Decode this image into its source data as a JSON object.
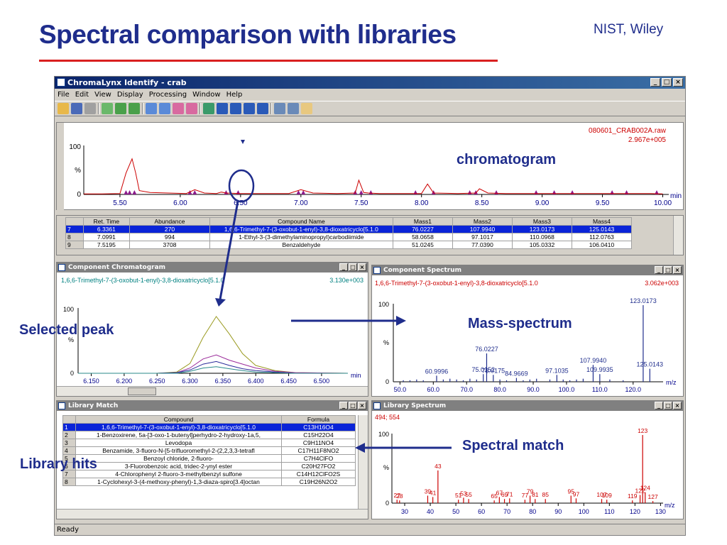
{
  "slide": {
    "title": "Spectral comparison with libraries",
    "source": "NIST, Wiley"
  },
  "app": {
    "title": "ChromaLynx Identify - crab",
    "menu": [
      "File",
      "Edit",
      "View",
      "Display",
      "Processing",
      "Window",
      "Help"
    ],
    "status": "Ready"
  },
  "chromatogram": {
    "file": "080601_CRAB002A.raw",
    "intensity": "2.967e+005",
    "y_top": "100",
    "y_pct": "%",
    "y_zero": "0",
    "x_unit": "min",
    "x_ticks": [
      "5.50",
      "6.00",
      "6.50",
      "7.00",
      "7.50",
      "8.00",
      "8.50",
      "9.00",
      "9.50",
      "10.00"
    ]
  },
  "results_table": {
    "headers": [
      "",
      "Ret. Time",
      "Abundance",
      "Compound Name",
      "Mass1",
      "Mass2",
      "Mass3",
      "Mass4"
    ],
    "rows": [
      [
        "7",
        "6.3361",
        "270",
        "1,6,6-Trimethyl-7-(3-oxobut-1-enyl)-3,8-dioxatricyclo[5.1.0",
        "76.0227",
        "107.9940",
        "123.0173",
        "125.0143"
      ],
      [
        "8",
        "7.0991",
        "994",
        "1-Ethyl-3-(3-dimethylaminopropyl)carbodiimide",
        "58.0658",
        "97.1017",
        "110.0968",
        "112.0763"
      ],
      [
        "9",
        "7.5195",
        "3708",
        "Benzaldehyde",
        "51.0245",
        "77.0390",
        "105.0332",
        "106.0410"
      ]
    ]
  },
  "component_chromatogram": {
    "title": "Component Chromatogram",
    "compound": "1,6,6-Trimethyl-7-(3-oxobut-1-enyl)-3,8-dioxatricyclo[5.1.0",
    "intensity": "3.130e+003",
    "y_top": "100",
    "y_pct": "%",
    "y_zero": "0",
    "x_unit": "min",
    "x_ticks": [
      "6.150",
      "6.200",
      "6.250",
      "6.300",
      "6.350",
      "6.400",
      "6.450",
      "6.500"
    ]
  },
  "component_spectrum": {
    "title": "Component Spectrum",
    "compound": "1,6,6-Trimethyl-7-(3-oxobut-1-enyl)-3,8-dioxatricyclo[5.1.0",
    "intensity": "3.062e+003",
    "y_top": "100",
    "y_pct": "%",
    "y_zero": "0",
    "x_unit": "m/z",
    "x_ticks": [
      "50.0",
      "60.0",
      "70.0",
      "80.0",
      "90.0",
      "100.0",
      "110.0",
      "120.0"
    ],
    "peak_labels": [
      "60.9996",
      "75.0152",
      "76.0227",
      "78.0175",
      "84.9669",
      "97.1035",
      "107.9940",
      "109.9935",
      "123.0173",
      "125.0143"
    ]
  },
  "library_match": {
    "title": "Library Match",
    "headers": [
      "",
      "Compound",
      "Formula"
    ],
    "rows": [
      [
        "1",
        "1,6,6-Trimethyl-7-(3-oxobut-1-enyl)-3,8-dioxatricyclo[5.1.0",
        "C13H16O4"
      ],
      [
        "2",
        "1-Benzoxirene, 5a-[3-oxo-1-butenyl]perhydro-2-hydroxy-1a,5,",
        "C15H22O4"
      ],
      [
        "3",
        "Levodopa",
        "C9H11NO4"
      ],
      [
        "4",
        "Benzamide, 3-fluoro-N-[5-trifluoromethyl-2-(2,2,3,3-tetrafl",
        "C17H11F8NO2"
      ],
      [
        "5",
        "Benzoyl chloride, 2-fluoro-",
        "C7H4ClFO"
      ],
      [
        "6",
        "3-Fluorobenzoic acid, tridec-2-ynyl ester",
        "C20H27FO2"
      ],
      [
        "7",
        "4-Chlorophenyl 2-fluoro-3-methylbenzyl sulfone",
        "C14H12ClFO2S"
      ],
      [
        "8",
        "1-Cyclohexyl-3-(4-methoxy-phenyl)-1,3-diaza-spiro[3.4]octan",
        "C19H26N2O2"
      ]
    ]
  },
  "library_spectrum": {
    "title": "Library Spectrum",
    "header": "494; 554",
    "y_top": "100",
    "y_pct": "%",
    "y_zero": "0",
    "x_unit": "m/z",
    "x_ticks": [
      "30",
      "40",
      "50",
      "60",
      "70",
      "80",
      "90",
      "100",
      "110",
      "120",
      "130"
    ],
    "peak_labels": [
      "27",
      "28",
      "39",
      "41",
      "43",
      "51",
      "53",
      "55",
      "65",
      "67",
      "69",
      "71",
      "77",
      "79",
      "81",
      "85",
      "95",
      "97",
      "107",
      "109",
      "119",
      "122",
      "123",
      "124",
      "127"
    ]
  },
  "annotations": {
    "chromatogram": "chromatogram",
    "mass_spectrum": "Mass-spectrum",
    "selected_peak": "Selected peak",
    "spectral_match": "Spectral match",
    "library_hits": "Library hits"
  },
  "colors": {
    "accent_blue": "#1f2d8c",
    "title_rule": "#d92020",
    "trace_red": "#cc0000",
    "selection": "#0a24d8"
  },
  "chart_data": [
    {
      "type": "line",
      "title": "080601_CRAB002A.raw",
      "xlabel": "min",
      "xlim": [
        5.2,
        10.05
      ],
      "ylim": [
        0,
        100
      ],
      "series": [
        {
          "x": [
            5.2,
            5.35,
            5.5,
            5.55,
            5.6,
            5.63,
            5.66,
            5.75,
            5.9,
            6.05,
            6.12,
            6.2,
            6.3,
            6.34,
            6.38,
            6.5,
            6.7,
            6.9,
            7.0,
            7.1,
            7.3,
            7.45,
            7.48,
            7.52,
            7.56,
            7.65,
            7.8,
            8.0,
            8.05,
            8.1,
            8.3,
            8.45,
            8.48,
            8.55,
            8.7,
            9.0,
            9.3,
            9.6,
            9.9,
            10.0
          ],
          "y": [
            1,
            1,
            2,
            45,
            75,
            45,
            8,
            4,
            3,
            2,
            10,
            3,
            2,
            5,
            3,
            2,
            2,
            2,
            10,
            3,
            2,
            3,
            30,
            4,
            3,
            2,
            2,
            2,
            22,
            3,
            2,
            3,
            12,
            3,
            2,
            2,
            2,
            2,
            2,
            1
          ]
        }
      ]
    },
    {
      "type": "line",
      "title": "1,6,6-Trimethyl-7-(3-oxobut-1-enyl)-3,8-dioxatricyclo[5.1.0",
      "xlabel": "min",
      "xlim": [
        6.13,
        6.54
      ],
      "ylim": [
        0,
        100
      ],
      "series": [
        {
          "x": [
            6.13,
            6.25,
            6.28,
            6.3,
            6.32,
            6.34,
            6.36,
            6.38,
            6.4,
            6.43,
            6.46,
            6.54
          ],
          "y": [
            0,
            0,
            2,
            15,
            55,
            87,
            60,
            30,
            12,
            4,
            1,
            0
          ]
        },
        {
          "x": [
            6.13,
            6.25,
            6.28,
            6.3,
            6.32,
            6.34,
            6.36,
            6.38,
            6.4,
            6.43,
            6.46,
            6.54
          ],
          "y": [
            0,
            0,
            1,
            8,
            22,
            28,
            20,
            14,
            8,
            3,
            1,
            0
          ]
        },
        {
          "x": [
            6.13,
            6.25,
            6.28,
            6.3,
            6.32,
            6.34,
            6.36,
            6.38,
            6.4,
            6.43,
            6.46,
            6.54
          ],
          "y": [
            0,
            0,
            1,
            5,
            14,
            18,
            12,
            7,
            4,
            2,
            0,
            0
          ]
        },
        {
          "x": [
            6.13,
            6.25,
            6.28,
            6.3,
            6.32,
            6.34,
            6.36,
            6.38,
            6.4,
            6.43,
            6.46,
            6.54
          ],
          "y": [
            0,
            0,
            0,
            3,
            8,
            10,
            7,
            4,
            2,
            1,
            0,
            0
          ]
        }
      ]
    },
    {
      "type": "bar",
      "title": "1,6,6-Trimethyl-7-(3-oxobut-1-enyl)-3,8-dioxatricyclo[5.1.0",
      "xlabel": "m/z",
      "xlim": [
        48,
        129
      ],
      "ylim": [
        0,
        100
      ],
      "x": [
        51,
        53,
        55,
        57,
        60.9996,
        63,
        65,
        67,
        69,
        71,
        73,
        75.0152,
        76.0227,
        78.0175,
        80,
        82,
        84.9669,
        87,
        89,
        91,
        95,
        97.1035,
        99,
        101,
        103,
        105,
        107.994,
        109.9935,
        113,
        117,
        123.0173,
        125.0143
      ],
      "values": [
        2,
        2,
        3,
        2,
        8,
        3,
        4,
        3,
        2,
        4,
        3,
        10,
        37,
        9,
        3,
        2,
        5,
        2,
        3,
        4,
        3,
        9,
        3,
        2,
        3,
        4,
        22,
        10,
        3,
        2,
        100,
        17
      ]
    },
    {
      "type": "bar",
      "title": "494; 554",
      "xlabel": "m/z",
      "xlim": [
        25,
        131
      ],
      "ylim": [
        0,
        100
      ],
      "x": [
        27,
        28,
        39,
        41,
        43,
        51,
        53,
        55,
        65,
        67,
        69,
        71,
        77,
        79,
        81,
        85,
        95,
        97,
        107,
        109,
        119,
        122,
        123,
        124,
        127
      ],
      "values": [
        5,
        4,
        11,
        9,
        48,
        5,
        8,
        6,
        4,
        9,
        6,
        7,
        5,
        11,
        6,
        6,
        11,
        7,
        6,
        5,
        4,
        12,
        100,
        16,
        3
      ]
    }
  ]
}
